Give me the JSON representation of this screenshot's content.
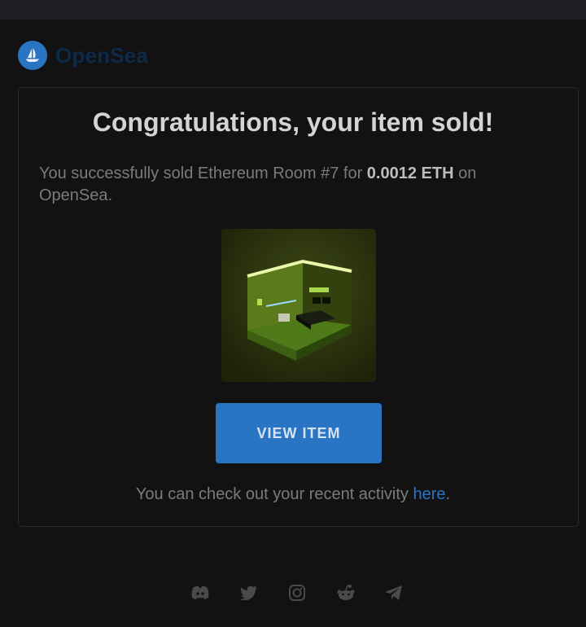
{
  "brand": {
    "name": "OpenSea",
    "accent": "#2a74c4"
  },
  "email": {
    "title": "Congratulations, your item sold!",
    "message_prefix": "You successfully sold Ethereum Room #7 for ",
    "price": "0.0012 ETH",
    "message_suffix": " on OpenSea.",
    "item": {
      "name": "Ethereum Room #7",
      "image_icon": "nft-room-image"
    },
    "cta_label": "VIEW ITEM",
    "activity_text": "You can check out your recent activity ",
    "activity_link": "here",
    "activity_end": "."
  },
  "footer": {
    "social_icons": [
      "discord-icon",
      "twitter-icon",
      "instagram-icon",
      "reddit-icon",
      "telegram-icon"
    ]
  }
}
